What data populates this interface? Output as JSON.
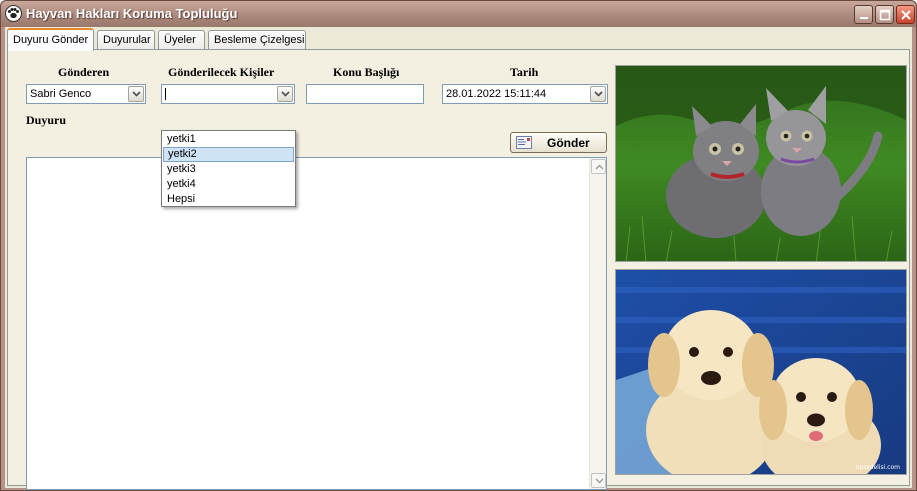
{
  "window": {
    "title": "Hayvan Hakları Koruma Topluluğu",
    "icon": "paw-icon",
    "controls": [
      "minimize-icon",
      "maximize-icon",
      "close-icon"
    ]
  },
  "tabs": [
    {
      "label": "Duyuru Gönder",
      "active": true
    },
    {
      "label": "Duyurular",
      "active": false
    },
    {
      "label": "Üyeler",
      "active": false
    },
    {
      "label": "Besleme Çizelgesi",
      "active": false
    }
  ],
  "form": {
    "sender_header": "Gönderen",
    "sender_value": "Sabri Genco",
    "recipients_header": "Gönderilecek Kişiler",
    "recipients_value": "",
    "subject_header": "Konu Başlığı",
    "subject_value": "",
    "date_header": "Tarih",
    "date_value": "28.01.2022 15:11:44",
    "message_label": "Duyuru",
    "message_value": "",
    "send_label": "Gönder",
    "send_icon": "envelope-icon"
  },
  "dropdown": {
    "options": [
      "yetki1",
      "yetki2",
      "yetki3",
      "yetki4",
      "Hepsi"
    ],
    "highlighted": "yetki2"
  },
  "images": {
    "top": "kittens-photo",
    "bottom": "puppies-photo",
    "bottom_watermark": "kpssdelisi.com"
  },
  "colors": {
    "titlebar": "#b69287",
    "panel": "#f3f0e2",
    "tab_accent": "#e68b2c",
    "selection": "#cfe3f7"
  }
}
